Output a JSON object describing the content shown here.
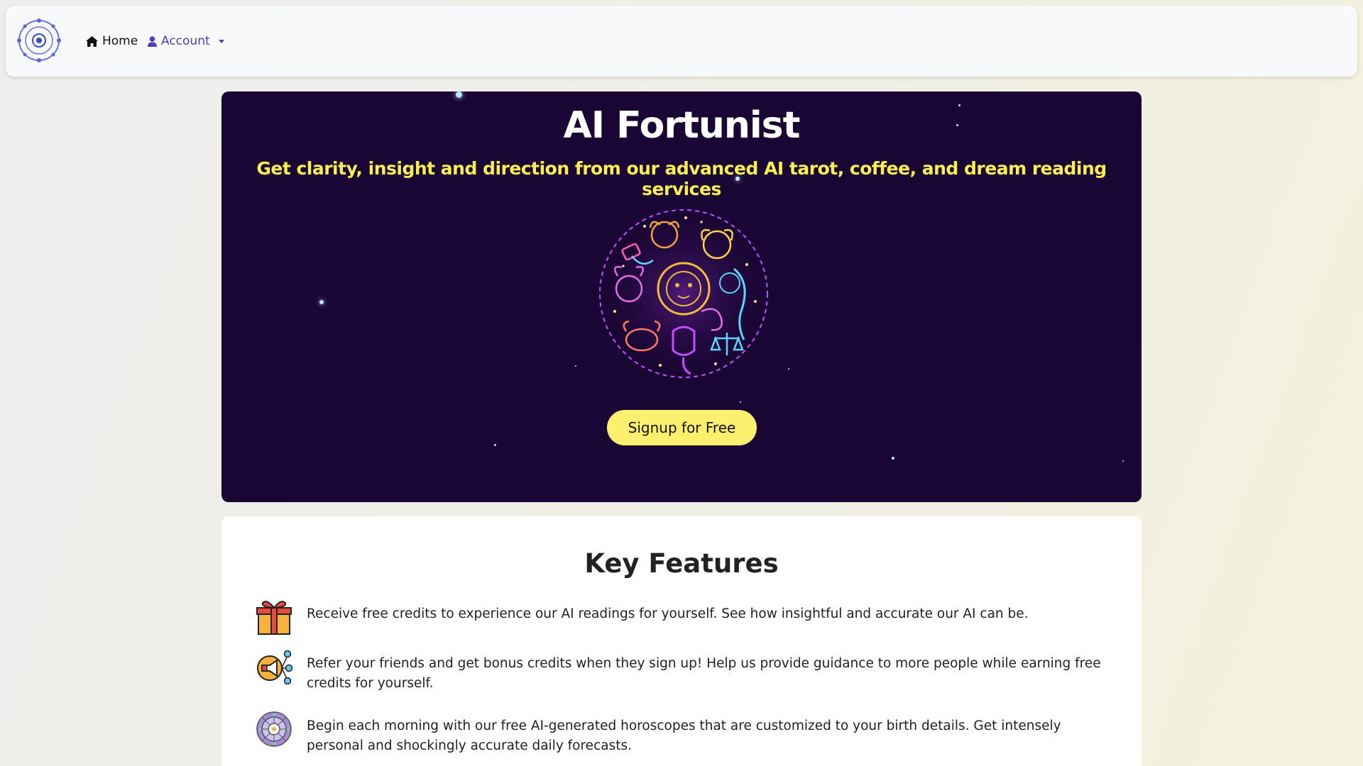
{
  "nav": {
    "logo_icon": "zodiac-wheel-logo-icon",
    "home_label": "Home",
    "home_icon": "home-icon",
    "account_label": "Account",
    "account_icon": "user-icon"
  },
  "hero": {
    "title": "AI Fortunist",
    "subtitle": "Get clarity, insight and direction from our advanced AI tarot, coffee, and dream reading services",
    "image_icon": "neon-zodiac-circle-illustration",
    "signup_label": "Signup for Free",
    "background_color": "#1a0635",
    "subtitle_color": "#f9ef4f",
    "button_color": "#fdf06e"
  },
  "features": {
    "title": "Key Features",
    "items": [
      {
        "icon": "gift-icon",
        "text": "Receive free credits to experience our AI readings for yourself. See how insightful and accurate our AI can be."
      },
      {
        "icon": "megaphone-share-icon",
        "text": "Refer your friends and get bonus credits when they sign up! Help us provide guidance to more people while earning free credits for yourself."
      },
      {
        "icon": "horoscope-wheel-icon",
        "text": "Begin each morning with our free AI-generated horoscopes that are customized to your birth details. Get intensely personal and shockingly accurate daily forecasts."
      }
    ]
  },
  "colors": {
    "accent": "#4a3fb8",
    "navbar_bg": "#f8f9fa"
  }
}
